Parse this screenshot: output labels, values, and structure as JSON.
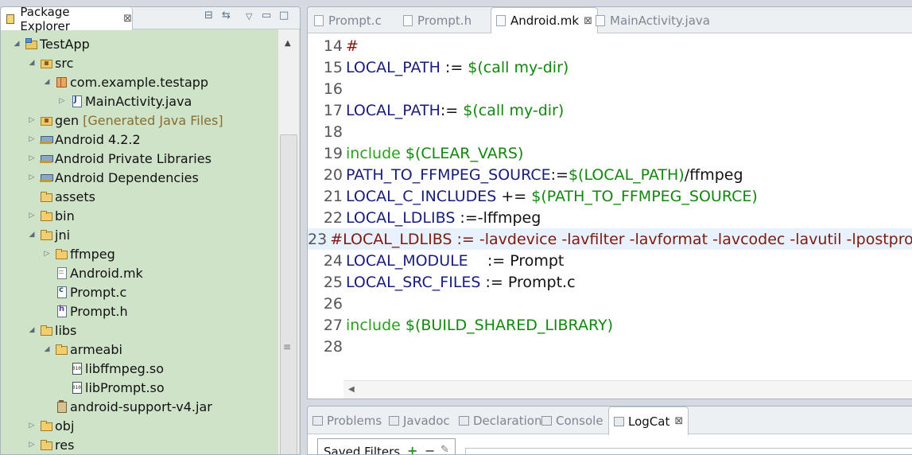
{
  "package_explorer": {
    "tab_label": "Package Explorer",
    "tab_close": "⊠",
    "tree": [
      {
        "label": "TestApp",
        "extra": "",
        "expander": "◢",
        "icon": "project-icon"
      },
      {
        "label": "src",
        "extra": "",
        "expander": "◢",
        "icon": "source-folder-icon"
      },
      {
        "label": "com.example.testapp",
        "extra": "",
        "expander": "◢",
        "icon": "package-icon"
      },
      {
        "label": "MainActivity.java",
        "extra": "",
        "expander": "▷",
        "icon": "java-file-icon"
      },
      {
        "label": "gen",
        "extra": "[Generated Java Files]",
        "expander": "▷",
        "icon": "source-folder-icon"
      },
      {
        "label": "Android 4.2.2",
        "extra": "",
        "expander": "▷",
        "icon": "library-icon"
      },
      {
        "label": "Android Private Libraries",
        "extra": "",
        "expander": "▷",
        "icon": "library-icon"
      },
      {
        "label": "Android Dependencies",
        "extra": "",
        "expander": "▷",
        "icon": "library-icon"
      },
      {
        "label": "assets",
        "extra": "",
        "expander": "",
        "icon": "folder-icon"
      },
      {
        "label": "bin",
        "extra": "",
        "expander": "▷",
        "icon": "folder-icon"
      },
      {
        "label": "jni",
        "extra": "",
        "expander": "◢",
        "icon": "folder-icon"
      },
      {
        "label": "ffmpeg",
        "extra": "",
        "expander": "▷",
        "icon": "folder-icon"
      },
      {
        "label": "Android.mk",
        "extra": "",
        "expander": "",
        "icon": "file-icon"
      },
      {
        "label": "Prompt.c",
        "extra": "",
        "expander": "",
        "icon": "c-file-icon"
      },
      {
        "label": "Prompt.h",
        "extra": "",
        "expander": "",
        "icon": "h-file-icon"
      },
      {
        "label": "libs",
        "extra": "",
        "expander": "◢",
        "icon": "folder-icon"
      },
      {
        "label": "armeabi",
        "extra": "",
        "expander": "◢",
        "icon": "folder-icon"
      },
      {
        "label": "libffmpeg.so",
        "extra": "",
        "expander": "",
        "icon": "binary-file-icon"
      },
      {
        "label": "libPrompt.so",
        "extra": "",
        "expander": "",
        "icon": "binary-file-icon"
      },
      {
        "label": "android-support-v4.jar",
        "extra": "",
        "expander": "",
        "icon": "jar-file-icon"
      },
      {
        "label": "obj",
        "extra": "",
        "expander": "▷",
        "icon": "folder-icon"
      },
      {
        "label": "res",
        "extra": "",
        "expander": "▷",
        "icon": "folder-icon"
      }
    ]
  },
  "editor": {
    "tabs": [
      {
        "label": "Prompt.c",
        "active": false
      },
      {
        "label": "Prompt.h",
        "active": false
      },
      {
        "label": "Android.mk",
        "active": true
      },
      {
        "label": "MainActivity.java",
        "active": false
      }
    ],
    "tab_close": "⊠",
    "lines": [
      {
        "num": "14",
        "parts": [
          {
            "t": "#",
            "c": "cm"
          }
        ]
      },
      {
        "num": "15",
        "parts": [
          {
            "t": "LOCAL_PATH",
            "c": "var"
          },
          {
            "t": " := ",
            "c": "op"
          },
          {
            "t": "$(call my-dir)",
            "c": "fn"
          }
        ]
      },
      {
        "num": "16",
        "parts": []
      },
      {
        "num": "17",
        "parts": [
          {
            "t": "LOCAL_PATH",
            "c": "var"
          },
          {
            "t": ":= ",
            "c": "op"
          },
          {
            "t": "$(call my-dir)",
            "c": "fn"
          }
        ]
      },
      {
        "num": "18",
        "parts": []
      },
      {
        "num": "19",
        "parts": [
          {
            "t": "include",
            "c": "kw"
          },
          {
            "t": " $(CLEAR_VARS)",
            "c": "fn"
          }
        ]
      },
      {
        "num": "20",
        "parts": [
          {
            "t": "PATH_TO_FFMPEG_SOURCE",
            "c": "var"
          },
          {
            "t": ":=",
            "c": "op"
          },
          {
            "t": "$(LOCAL_PATH)",
            "c": "fn"
          },
          {
            "t": "/ffmpeg",
            "c": "op"
          }
        ]
      },
      {
        "num": "21",
        "parts": [
          {
            "t": "LOCAL_C_INCLUDES",
            "c": "var"
          },
          {
            "t": " += ",
            "c": "op"
          },
          {
            "t": "$(PATH_TO_FFMPEG_SOURCE)",
            "c": "fn"
          }
        ]
      },
      {
        "num": "22",
        "parts": [
          {
            "t": "LOCAL_LDLIBS",
            "c": "var"
          },
          {
            "t": " :=-lffmpeg",
            "c": "op"
          }
        ]
      },
      {
        "num": "23",
        "parts": [
          {
            "t": "#LOCAL_LDLIBS := -lavdevice -lavfilter -lavformat -lavcodec -lavutil -lpostproc",
            "c": "cm"
          }
        ],
        "highlight": true
      },
      {
        "num": "24",
        "parts": [
          {
            "t": "LOCAL_MODULE",
            "c": "var"
          },
          {
            "t": "    := Prompt",
            "c": "op"
          }
        ]
      },
      {
        "num": "25",
        "parts": [
          {
            "t": "LOCAL_SRC_FILES",
            "c": "var"
          },
          {
            "t": " := Prompt.c",
            "c": "op"
          }
        ]
      },
      {
        "num": "26",
        "parts": []
      },
      {
        "num": "27",
        "parts": [
          {
            "t": "include",
            "c": "kw"
          },
          {
            "t": " $(BUILD_SHARED_LIBRARY)",
            "c": "fn"
          }
        ]
      },
      {
        "num": "28",
        "parts": []
      }
    ]
  },
  "bottom_views": {
    "tabs": [
      {
        "label": "Problems",
        "active": false,
        "icon": "problems-icon"
      },
      {
        "label": "Javadoc",
        "active": false,
        "icon": "javadoc-icon"
      },
      {
        "label": "Declaration",
        "active": false,
        "icon": "declaration-icon"
      },
      {
        "label": "Console",
        "active": false,
        "icon": "console-icon"
      },
      {
        "label": "LogCat",
        "active": true,
        "icon": "logcat-icon"
      }
    ],
    "tab_close": "⊠",
    "saved_filters_label": "Saved Filters"
  }
}
